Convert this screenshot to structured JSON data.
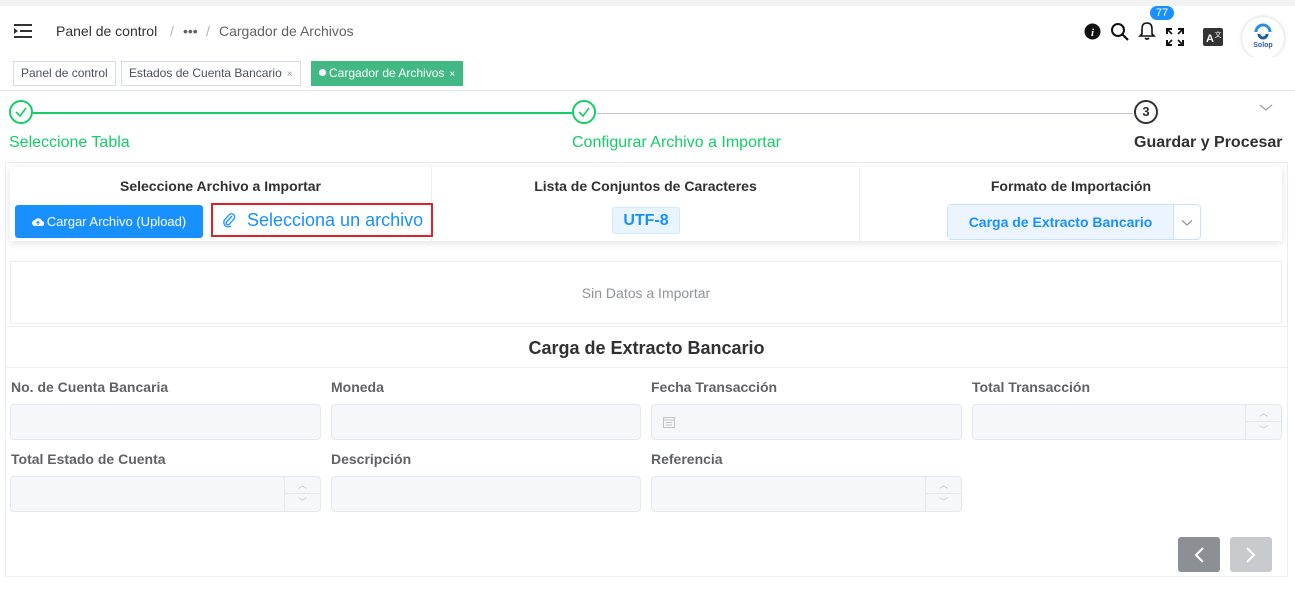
{
  "header": {
    "breadcrumb": [
      "Panel de control",
      "Cargador de Archivos"
    ],
    "breadcrumb_more": "•••",
    "separator": "/",
    "notification_count": "77",
    "avatar_text": "Solop",
    "icons": [
      "info-icon",
      "search-icon",
      "bell-icon",
      "fullscreen-icon",
      "translate-icon"
    ]
  },
  "tags": [
    {
      "label": "Panel de control"
    },
    {
      "label": "Estados de Cuenta Bancario"
    },
    {
      "label": "Cargador de Archivos"
    }
  ],
  "tag_close": "×",
  "steps": {
    "items": [
      {
        "label": "Seleccione Tabla",
        "status": "done"
      },
      {
        "label": "Configurar Archivo a Importar",
        "status": "done"
      },
      {
        "label": "Guardar y Procesar",
        "status": "current",
        "number": "3"
      }
    ]
  },
  "upload": {
    "file_title": "Seleccione Archivo a Importar",
    "upload_button": "Cargar Archivo (Upload)",
    "select_file": "Selecciona un archivo",
    "charset_title": "Lista de Conjuntos de Caracteres",
    "charset_value": "UTF-8",
    "format_title": "Formato de Importación",
    "format_value": "Carga de Extracto Bancario"
  },
  "no_data": "Sin Datos a Importar",
  "form": {
    "title": "Carga de Extracto Bancario",
    "fields": [
      {
        "label": "No. de Cuenta Bancaria"
      },
      {
        "label": "Moneda"
      },
      {
        "label": "Fecha Transacción"
      },
      {
        "label": "Total Transacción"
      },
      {
        "label": "Total Estado de Cuenta"
      },
      {
        "label": "Descripción"
      },
      {
        "label": "Referencia"
      }
    ]
  },
  "colors": {
    "accent": "#1890ff",
    "success": "#13ce66",
    "tag_active": "#42b983",
    "highlight": "#d8232a"
  }
}
